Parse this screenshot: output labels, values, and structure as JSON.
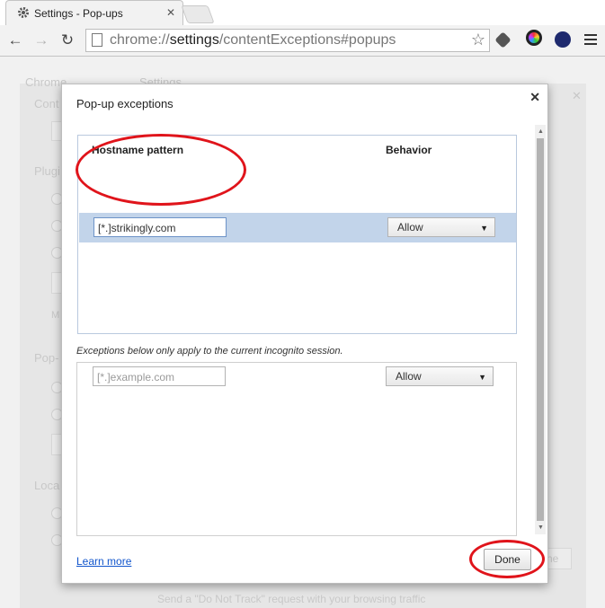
{
  "browser": {
    "tab_title": "Settings - Pop-ups",
    "tab_close": "✕",
    "url_prefix": "chrome://",
    "url_host": "settings",
    "url_path": "/contentExceptions#popups"
  },
  "background": {
    "texts": [
      "Chrome",
      "Settings",
      "Cont",
      "Plugi",
      "M",
      "Pop-",
      "Loca",
      "Send a \"Do Not Track\" request with your browsing traffic",
      "ne"
    ]
  },
  "dialog": {
    "title": "Pop-up exceptions",
    "close": "✕",
    "columns": {
      "hostname": "Hostname pattern",
      "behavior": "Behavior"
    },
    "exceptions": [
      {
        "hostname": "[*.]strikingly.com",
        "behavior": "Allow"
      }
    ],
    "incognito_note": "Exceptions below only apply to the current incognito session.",
    "incognito_row": {
      "placeholder": "[*.]example.com",
      "behavior": "Allow"
    },
    "learn_more": "Learn more",
    "done": "Done"
  },
  "colors": {
    "annotation_ring": "#e0141b",
    "selection": "#c2d4ea",
    "link": "#1155cc"
  }
}
